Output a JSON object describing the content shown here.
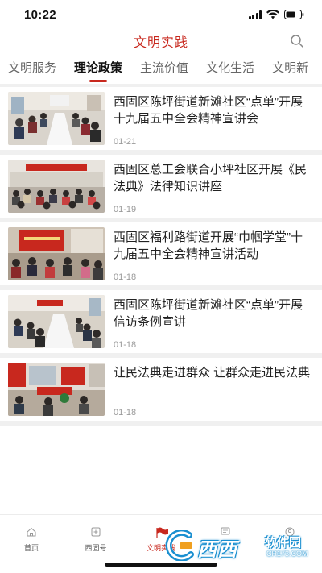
{
  "status_bar": {
    "time": "10:22"
  },
  "header": {
    "title": "文明实践",
    "search_icon": "search-icon"
  },
  "tabs": [
    {
      "label": "文明服务",
      "active": false
    },
    {
      "label": "理论政策",
      "active": true
    },
    {
      "label": "主流价值",
      "active": false
    },
    {
      "label": "文化生活",
      "active": false
    },
    {
      "label": "文明新",
      "active": false
    }
  ],
  "news": [
    {
      "title": "西固区陈坪街道新滩社区“点单”开展十九届五中全会精神宣讲会",
      "date": "01-21"
    },
    {
      "title": "西固区总工会联合小坪社区开展《民法典》法律知识讲座",
      "date": "01-19"
    },
    {
      "title": "西固区福利路街道开展“巾帼学堂”十九届五中全会精神宣讲活动",
      "date": "01-18"
    },
    {
      "title": "西固区陈坪街道新滩社区“点单”开展信访条例宣讲",
      "date": "01-18"
    },
    {
      "title": "让民法典走进群众 让群众走进民法典",
      "date": "01-18"
    }
  ],
  "tabbar": [
    {
      "label": "首页",
      "icon": "home-icon"
    },
    {
      "label": "西固号",
      "icon": "plus-square-icon"
    },
    {
      "label": "文明实践",
      "icon": "flag-icon"
    },
    {
      "label": "",
      "icon": "message-icon"
    },
    {
      "label": "",
      "icon": "user-icon"
    }
  ],
  "watermark": {
    "brand": "西西",
    "name": "软件园",
    "url": "CR173.COM"
  },
  "colors": {
    "accent": "#c8281e",
    "watermark_blue": "#1a8fd0"
  }
}
